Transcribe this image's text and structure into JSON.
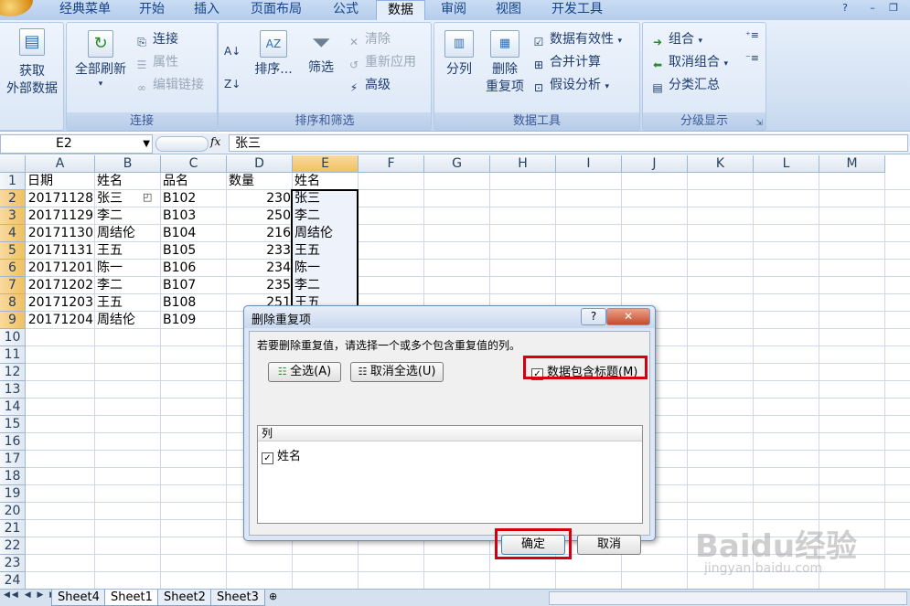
{
  "ribbon_tabs": [
    "经典菜单",
    "开始",
    "插入",
    "页面布局",
    "公式",
    "数据",
    "审阅",
    "视图",
    "开发工具"
  ],
  "active_tab": "数据",
  "groups": {
    "get_external": {
      "label_line1": "获取",
      "label_line2": "外部数据"
    },
    "connections": {
      "label": "连接",
      "refresh_all": "全部刷新",
      "connections_btn": "连接",
      "properties_btn": "属性",
      "edit_links_btn": "编辑链接"
    },
    "sort_filter": {
      "label": "排序和筛选",
      "sort_btn": "排序...",
      "filter_btn": "筛选",
      "clear_btn": "清除",
      "reapply_btn": "重新应用",
      "advanced_btn": "高级"
    },
    "data_tools": {
      "label": "数据工具",
      "text_to_columns": "分列",
      "remove_dup_line1": "删除",
      "remove_dup_line2": "重复项",
      "validation": "数据有效性",
      "consolidate": "合并计算",
      "what_if": "假设分析"
    },
    "outline": {
      "label": "分级显示",
      "group_btn": "组合",
      "ungroup_btn": "取消组合",
      "subtotal_btn": "分类汇总"
    }
  },
  "formula_bar": {
    "name_box": "E2",
    "fx": "fx",
    "value": "张三"
  },
  "columns": [
    "A",
    "B",
    "C",
    "D",
    "E",
    "F",
    "G",
    "H",
    "I",
    "J",
    "K",
    "L",
    "M"
  ],
  "rows": [
    "1",
    "2",
    "3",
    "4",
    "5",
    "6",
    "7",
    "8",
    "9",
    "10",
    "11",
    "12",
    "13",
    "14",
    "15",
    "16",
    "17",
    "18",
    "19",
    "20",
    "21",
    "22",
    "23",
    "24"
  ],
  "table": {
    "headers": [
      "日期",
      "姓名",
      "品名",
      "数量",
      "姓名"
    ],
    "data": [
      [
        "20171128",
        "张三",
        "B102",
        "230",
        "张三"
      ],
      [
        "20171129",
        "李二",
        "B103",
        "250",
        "李二"
      ],
      [
        "20171130",
        "周结伦",
        "B104",
        "216",
        "周结伦"
      ],
      [
        "20171131",
        "王五",
        "B105",
        "233",
        "王五"
      ],
      [
        "20171201",
        "陈一",
        "B106",
        "234",
        "陈一"
      ],
      [
        "20171202",
        "李二",
        "B107",
        "235",
        "李二"
      ],
      [
        "20171203",
        "王五",
        "B108",
        "251",
        "王五"
      ],
      [
        "20171204",
        "周结伦",
        "B109",
        "",
        ""
      ]
    ]
  },
  "dialog": {
    "title": "删除重复项",
    "help": "?",
    "close": "✕",
    "instruction": "若要删除重复值，请选择一个或多个包含重复值的列。",
    "select_all": "全选(A)",
    "unselect_all": "取消全选(U)",
    "has_headers": "数据包含标题(M)",
    "list_header": "列",
    "list_items": [
      "姓名"
    ],
    "ok": "确定",
    "cancel": "取消"
  },
  "sheets": [
    "Sheet4",
    "Sheet1",
    "Sheet2",
    "Sheet3"
  ],
  "active_sheet": "Sheet1",
  "watermark": {
    "line1": "Baidu经验",
    "line2": "jingyan.baidu.com"
  },
  "colors": {
    "accent_red": "#d40012",
    "selection": "#f1c15f",
    "ribbon": "#d3e1f3"
  }
}
